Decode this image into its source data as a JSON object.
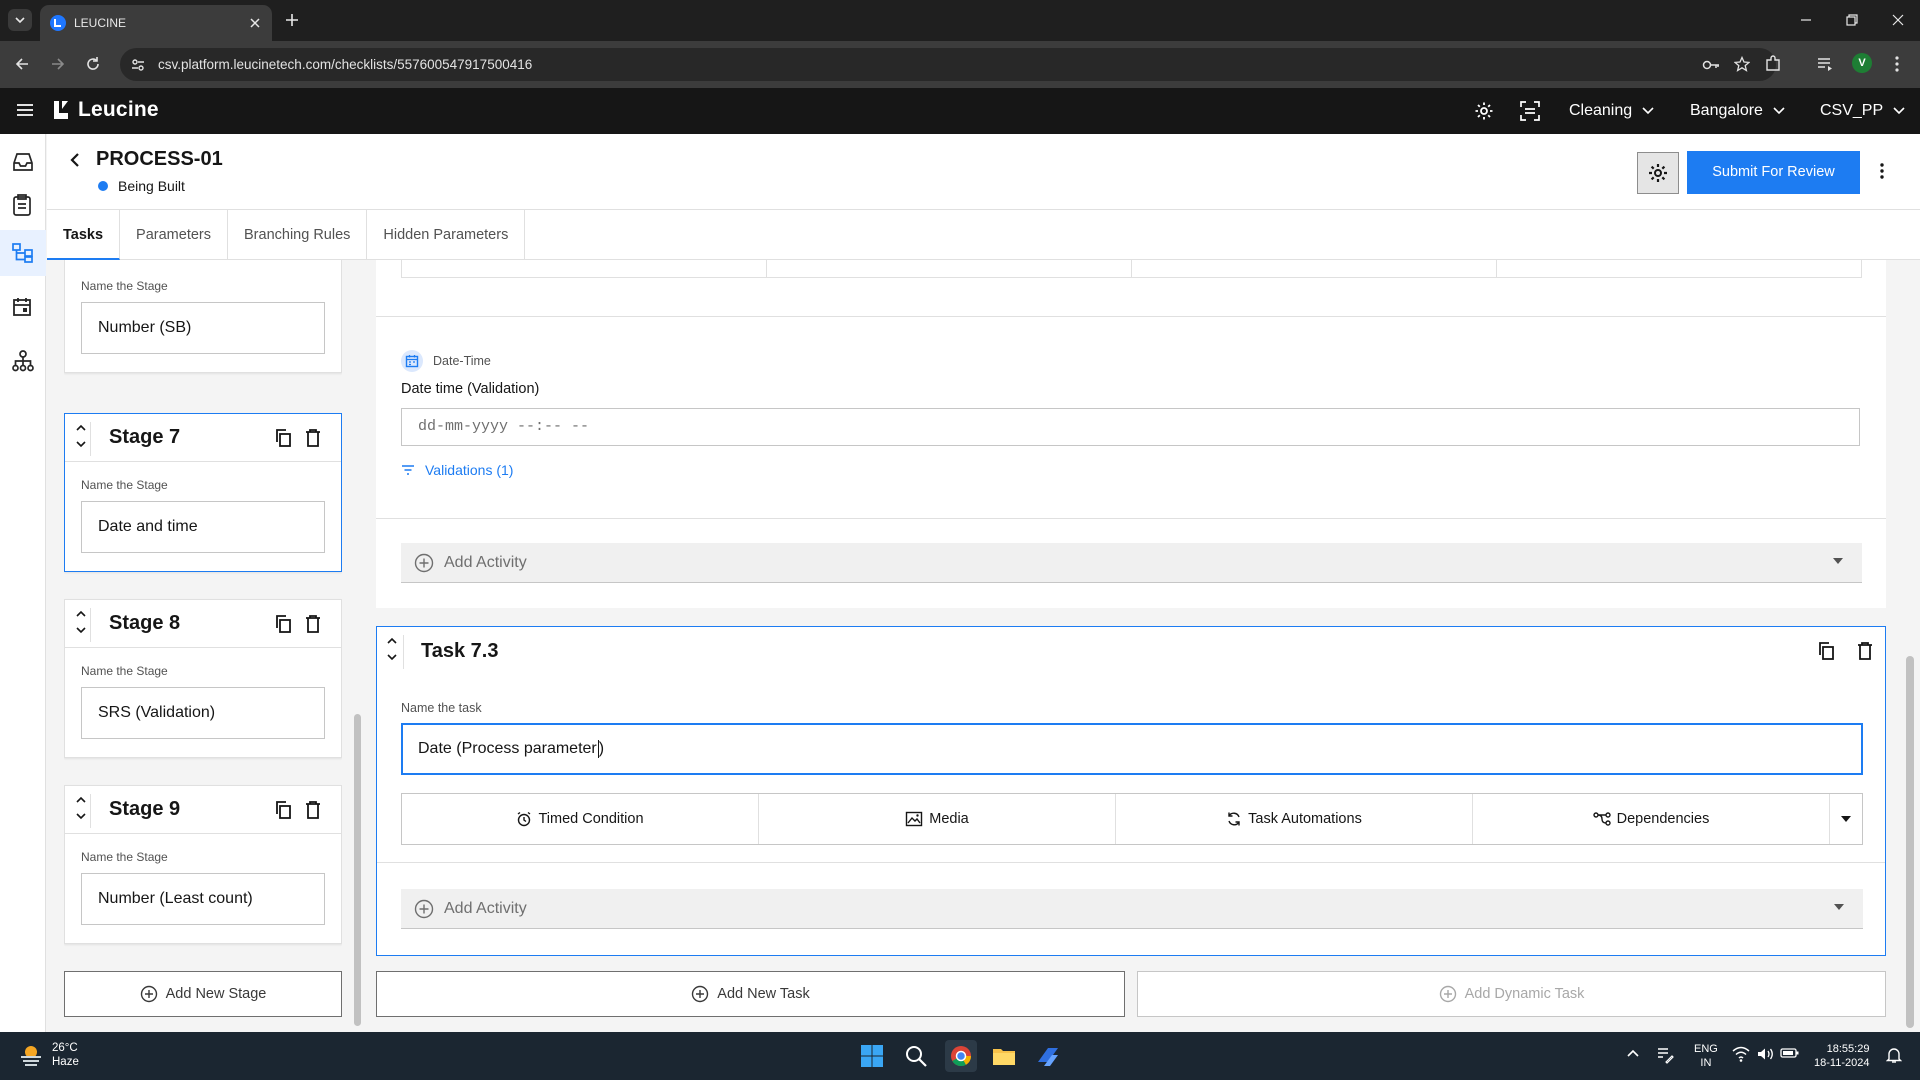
{
  "browser": {
    "tab_title": "LEUCINE",
    "url_host": "csv.platform.leucinetech.com",
    "url_path": "/checklists/557600547917500416",
    "profile_initial": "V"
  },
  "app": {
    "brand": "Leucine",
    "header_dropdowns": [
      {
        "label": "Cleaning"
      },
      {
        "label": "Bangalore"
      },
      {
        "label": "CSV_PP"
      }
    ]
  },
  "process": {
    "title": "PROCESS-01",
    "status": "Being Built",
    "status_color": "#1d7cf2",
    "submit_label": "Submit For Review"
  },
  "tabs": [
    {
      "label": "Tasks",
      "active": true
    },
    {
      "label": "Parameters"
    },
    {
      "label": "Branching Rules"
    },
    {
      "label": "Hidden Parameters"
    }
  ],
  "stages": [
    {
      "title": "",
      "name_label": "Name the Stage",
      "value": "Number (SB)"
    },
    {
      "title": "Stage 7",
      "name_label": "Name the Stage",
      "value": "Date and time",
      "selected": true
    },
    {
      "title": "Stage 8",
      "name_label": "Name the Stage",
      "value": "SRS (Validation)"
    },
    {
      "title": "Stage 9",
      "name_label": "Name the Stage",
      "value": "Number (Least count)"
    }
  ],
  "add_stage_label": "Add New Stage",
  "activity": {
    "type_label": "Date-Time",
    "label": "Date time (Validation)",
    "placeholder": "dd-mm-yyyy --:-- --",
    "validations_label": "Validations (1)"
  },
  "add_activity_label": "Add Activity",
  "task": {
    "title": "Task 7.3",
    "name_label": "Name the task",
    "value": "Date (Process parameter",
    "value_tail": ")",
    "toolbar": [
      {
        "label": "Timed Condition",
        "icon": "alarm-icon"
      },
      {
        "label": "Media",
        "icon": "image-icon"
      },
      {
        "label": "Task Automations",
        "icon": "sync-icon"
      },
      {
        "label": "Dependencies",
        "icon": "branch-icon"
      }
    ]
  },
  "add_task_label": "Add New Task",
  "add_dynamic_task_label": "Add Dynamic Task",
  "taskbar": {
    "temp": "26°C",
    "weather": "Haze",
    "lang_top": "ENG",
    "lang_bottom": "IN",
    "time": "18:55:29",
    "date": "18-11-2024"
  },
  "colors": {
    "accent": "#1d7cf2",
    "header_bg": "#161616",
    "chrome_bg": "#1f1f1f"
  }
}
